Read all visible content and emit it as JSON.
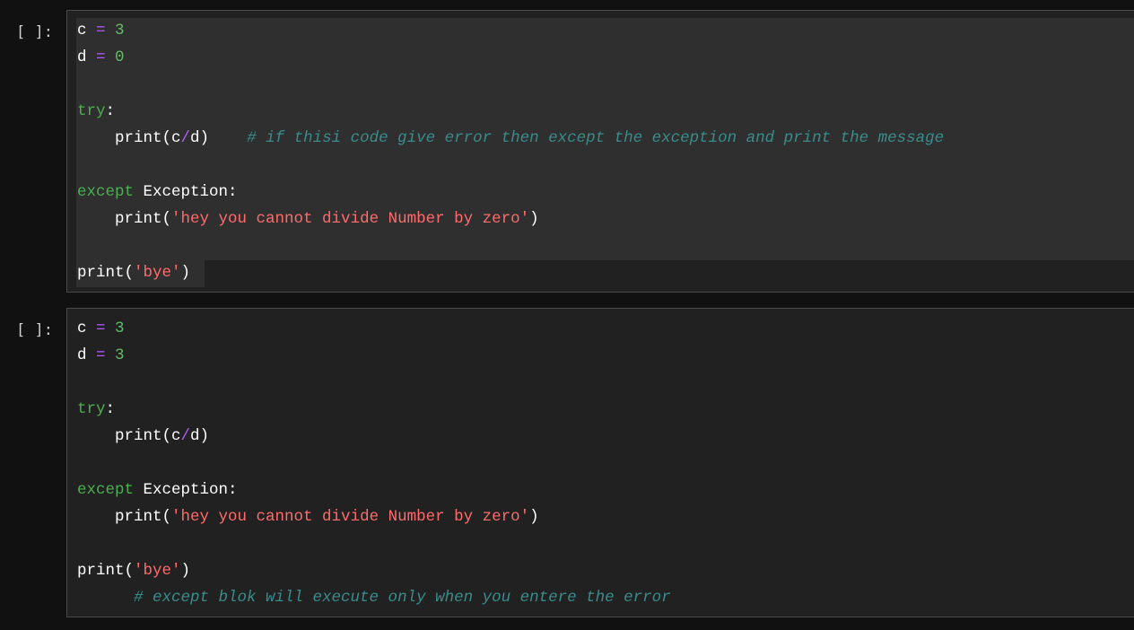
{
  "cells": [
    {
      "prompt": "[ ]:",
      "lines": [
        [
          {
            "t": "c ",
            "c": "nm"
          },
          {
            "t": "=",
            "c": "op"
          },
          {
            "t": " ",
            "c": "nm"
          },
          {
            "t": "3",
            "c": "num"
          }
        ],
        [
          {
            "t": "d ",
            "c": "nm"
          },
          {
            "t": "=",
            "c": "op"
          },
          {
            "t": " ",
            "c": "nm"
          },
          {
            "t": "0",
            "c": "num"
          }
        ],
        [],
        [
          {
            "t": "try",
            "c": "kw"
          },
          {
            "t": ":",
            "c": "nm"
          }
        ],
        [
          {
            "t": "    print(c",
            "c": "nm"
          },
          {
            "t": "/",
            "c": "op"
          },
          {
            "t": "d)    ",
            "c": "nm"
          },
          {
            "t": "# if thisi code give error then except the exception and print the message",
            "c": "cm"
          }
        ],
        [],
        [
          {
            "t": "except",
            "c": "kw"
          },
          {
            "t": " Exception:",
            "c": "nm"
          }
        ],
        [
          {
            "t": "    print(",
            "c": "nm"
          },
          {
            "t": "'hey you cannot divide Number by zero'",
            "c": "str"
          },
          {
            "t": ")",
            "c": "nm"
          }
        ],
        [],
        [
          {
            "t": "print(",
            "c": "nm"
          },
          {
            "t": "'bye'",
            "c": "str"
          },
          {
            "t": ")",
            "c": "nm"
          }
        ]
      ]
    },
    {
      "prompt": "[ ]:",
      "lines": [
        [
          {
            "t": "c ",
            "c": "nm"
          },
          {
            "t": "=",
            "c": "op"
          },
          {
            "t": " ",
            "c": "nm"
          },
          {
            "t": "3",
            "c": "num"
          }
        ],
        [
          {
            "t": "d ",
            "c": "nm"
          },
          {
            "t": "=",
            "c": "op"
          },
          {
            "t": " ",
            "c": "nm"
          },
          {
            "t": "3",
            "c": "num"
          }
        ],
        [],
        [
          {
            "t": "try",
            "c": "kw"
          },
          {
            "t": ":",
            "c": "nm"
          }
        ],
        [
          {
            "t": "    print(c",
            "c": "nm"
          },
          {
            "t": "/",
            "c": "op"
          },
          {
            "t": "d)",
            "c": "nm"
          }
        ],
        [],
        [
          {
            "t": "except",
            "c": "kw"
          },
          {
            "t": " Exception:",
            "c": "nm"
          }
        ],
        [
          {
            "t": "    print(",
            "c": "nm"
          },
          {
            "t": "'hey you cannot divide Number by zero'",
            "c": "str"
          },
          {
            "t": ")",
            "c": "nm"
          }
        ],
        [],
        [
          {
            "t": "print(",
            "c": "nm"
          },
          {
            "t": "'bye'",
            "c": "str"
          },
          {
            "t": ")",
            "c": "nm"
          }
        ],
        [
          {
            "t": "      ",
            "c": "nm"
          },
          {
            "t": "# except blok will execute only when you entere the error",
            "c": "cm"
          }
        ]
      ]
    }
  ]
}
